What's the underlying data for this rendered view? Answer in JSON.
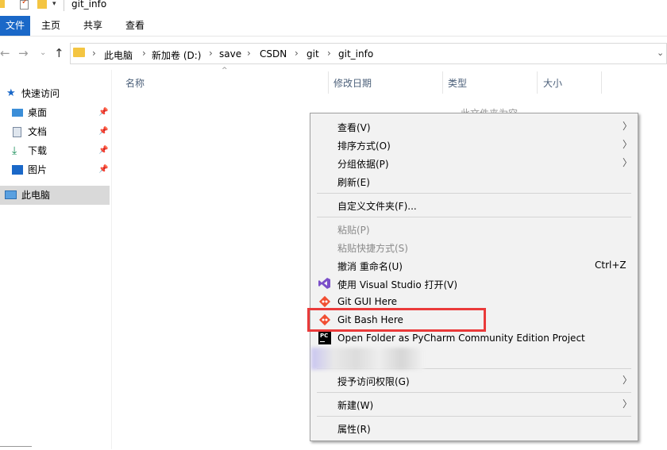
{
  "window": {
    "title": "git_info"
  },
  "ribbon": {
    "tabs": [
      "文件",
      "主页",
      "共享",
      "查看"
    ]
  },
  "address": {
    "crumbs": [
      "此电脑",
      "新加卷 (D:)",
      "save",
      "CSDN",
      "git",
      "git_info"
    ]
  },
  "columns": [
    "名称",
    "修改日期",
    "类型",
    "大小"
  ],
  "sidebar": {
    "quick_access": "快速访问",
    "items": [
      "桌面",
      "文档",
      "下载",
      "图片"
    ],
    "this_pc": "此电脑"
  },
  "empty_text": "此文件夹为空",
  "menu": {
    "view": "查看(V)",
    "sort": "排序方式(O)",
    "group": "分组依据(P)",
    "refresh": "刷新(E)",
    "customize": "自定义文件夹(F)...",
    "paste": "粘贴(P)",
    "paste_shortcut": "粘贴快捷方式(S)",
    "undo_rename": "撤消 重命名(U)",
    "undo_shortcut": "Ctrl+Z",
    "open_vs": "使用 Visual Studio 打开(V)",
    "git_gui": "Git GUI Here",
    "git_bash": "Git Bash Here",
    "pycharm": "Open Folder as PyCharm Community Edition Project",
    "give_access": "授予访问权限(G)",
    "new": "新建(W)",
    "properties": "属性(R)"
  },
  "colors": {
    "accent": "#1a68c8",
    "highlight_box": "#ea3a3a",
    "vs_purple": "#7b4fc9",
    "git_orange": "#f14e32"
  }
}
